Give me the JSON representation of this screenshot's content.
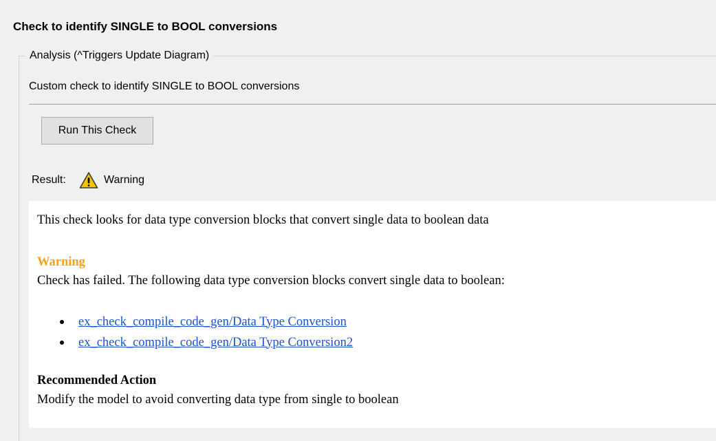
{
  "check": {
    "title": "Check to identify SINGLE to BOOL conversions"
  },
  "analysis": {
    "legend": "Analysis (^Triggers Update Diagram)",
    "description": "Custom check to identify SINGLE to BOOL conversions",
    "run_button_label": "Run This Check"
  },
  "result": {
    "label": "Result:",
    "status": "Warning",
    "status_icon": "warning-triangle-icon",
    "status_icon_color": "#f5c400"
  },
  "report": {
    "intro": "This check looks for data type conversion blocks that convert single data to boolean data",
    "warning_heading": "Warning",
    "warning_heading_color": "#f7a21b",
    "warning_message": "Check has failed. The following data type conversion blocks convert single data to boolean:",
    "blocks": [
      "ex_check_compile_code_gen/Data Type Conversion",
      "ex_check_compile_code_gen/Data Type Conversion2"
    ],
    "link_color": "#1a53c8",
    "recommended_action_heading": "Recommended Action",
    "recommended_action_text": "Modify the model to avoid converting data type from single to boolean"
  }
}
